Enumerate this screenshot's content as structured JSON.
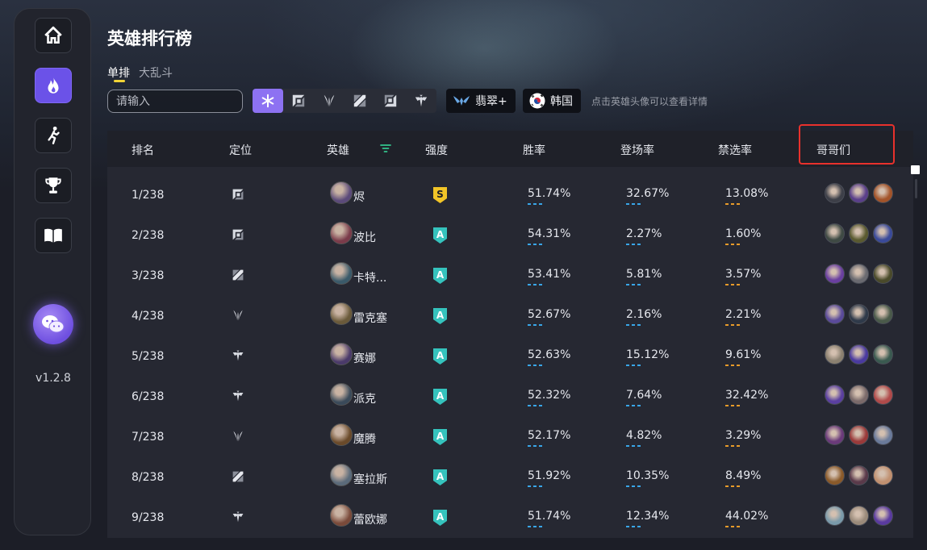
{
  "app": {
    "title": "英雄排行榜",
    "version": "v1.2.8",
    "accent_color": "#6b52e8"
  },
  "sidebar": {
    "items": [
      {
        "name": "home",
        "icon": "home-icon",
        "active": false
      },
      {
        "name": "hot",
        "icon": "flame-icon",
        "active": true
      },
      {
        "name": "runner",
        "icon": "runner-icon",
        "active": false
      },
      {
        "name": "trophy",
        "icon": "trophy-icon",
        "active": false
      },
      {
        "name": "guide",
        "icon": "book-icon",
        "active": false
      }
    ],
    "wechat_icon": "wechat-icon"
  },
  "modes": {
    "tabs": [
      "单排",
      "大乱斗"
    ],
    "active_index": 0
  },
  "search": {
    "placeholder": "请输入"
  },
  "roles": {
    "buttons": [
      "all-roles-icon",
      "top-lane-icon",
      "jungle-icon",
      "mid-lane-icon",
      "bot-lane-icon",
      "support-icon"
    ],
    "active_index": 0
  },
  "rank_filter": {
    "label": "翡翠+",
    "icon": "emerald-wings-icon"
  },
  "region_filter": {
    "label": "韩国",
    "icon": "korea-flag-icon"
  },
  "hint": "点击英雄头像可以查看详情",
  "table": {
    "headers": {
      "rank": "排名",
      "role": "定位",
      "hero": "英雄",
      "tier": "强度",
      "win_rate": "胜率",
      "pick_rate": "登场率",
      "ban_rate": "禁选率",
      "brothers": "哥哥们"
    },
    "rows": [
      {
        "rank": "1/238",
        "role": "top",
        "hero": "烬",
        "tier": "S",
        "win": "51.74%",
        "pick": "32.67%",
        "ban": "13.08%"
      },
      {
        "rank": "2/238",
        "role": "top",
        "hero": "波比",
        "tier": "A",
        "win": "54.31%",
        "pick": "2.27%",
        "ban": "1.60%"
      },
      {
        "rank": "3/238",
        "role": "mid",
        "hero": "卡特...",
        "tier": "A",
        "win": "53.41%",
        "pick": "5.81%",
        "ban": "3.57%"
      },
      {
        "rank": "4/238",
        "role": "jungle",
        "hero": "雷克塞",
        "tier": "A",
        "win": "52.67%",
        "pick": "2.16%",
        "ban": "2.21%"
      },
      {
        "rank": "5/238",
        "role": "support",
        "hero": "赛娜",
        "tier": "A",
        "win": "52.63%",
        "pick": "15.12%",
        "ban": "9.61%"
      },
      {
        "rank": "6/238",
        "role": "support",
        "hero": "派克",
        "tier": "A",
        "win": "52.32%",
        "pick": "7.64%",
        "ban": "32.42%"
      },
      {
        "rank": "7/238",
        "role": "jungle",
        "hero": "魔腾",
        "tier": "A",
        "win": "52.17%",
        "pick": "4.82%",
        "ban": "3.29%"
      },
      {
        "rank": "8/238",
        "role": "mid",
        "hero": "塞拉斯",
        "tier": "A",
        "win": "51.92%",
        "pick": "10.35%",
        "ban": "8.49%"
      },
      {
        "rank": "9/238",
        "role": "support",
        "hero": "蕾欧娜",
        "tier": "A",
        "win": "51.74%",
        "pick": "12.34%",
        "ban": "44.02%"
      }
    ]
  },
  "colors": {
    "tier_s": "#f2c527",
    "tier_a": "#35c3bd",
    "dash_blue": "#39a6e8",
    "dash_orange": "#e89b2a",
    "highlight": "#e8312c"
  }
}
